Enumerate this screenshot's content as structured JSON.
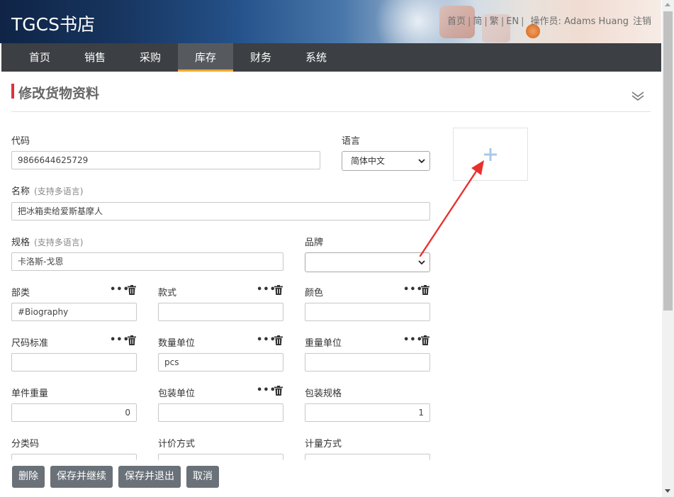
{
  "header": {
    "brand": "TGCS书店",
    "links": {
      "home": "首页",
      "simplified": "简",
      "traditional": "繁",
      "english": "EN"
    },
    "operator_label": "操作员: Adams Huang",
    "logout": "注销"
  },
  "nav": {
    "items": [
      {
        "label": "首页",
        "active": false
      },
      {
        "label": "销售",
        "active": false
      },
      {
        "label": "采购",
        "active": false
      },
      {
        "label": "库存",
        "active": true
      },
      {
        "label": "财务",
        "active": false
      },
      {
        "label": "系统",
        "active": false
      }
    ]
  },
  "page": {
    "title": "修改货物资料"
  },
  "form": {
    "code": {
      "label": "代码",
      "value": "9866644625729"
    },
    "language": {
      "label": "语言",
      "value": "简体中文"
    },
    "name": {
      "label": "名称",
      "hint": "(支持多语言)",
      "value": "把冰箱卖给爱斯基摩人"
    },
    "spec": {
      "label": "规格",
      "hint": "(支持多语言)",
      "value": "卡洛斯-戈恩"
    },
    "brand": {
      "label": "品牌",
      "value": ""
    },
    "category": {
      "label": "部类",
      "value": "#Biography"
    },
    "style": {
      "label": "款式",
      "value": ""
    },
    "color": {
      "label": "颜色",
      "value": ""
    },
    "size_standard": {
      "label": "尺码标准",
      "value": ""
    },
    "quantity_unit": {
      "label": "数量单位",
      "value": "pcs"
    },
    "weight_unit": {
      "label": "重量单位",
      "value": ""
    },
    "unit_weight": {
      "label": "单件重量",
      "value": "0"
    },
    "package_unit": {
      "label": "包装单位",
      "value": ""
    },
    "package_spec": {
      "label": "包装规格",
      "value": "1"
    },
    "classification_code": {
      "label": "分类码",
      "value": ""
    },
    "pricing_method": {
      "label": "计价方式",
      "value": ""
    },
    "measure_method": {
      "label": "计量方式",
      "value": ""
    },
    "more_icon": "ellipsis-icon",
    "delete_icon": "trash-icon"
  },
  "uploader": {
    "icon": "plus-icon"
  },
  "buttons": {
    "delete": "删除",
    "save_continue": "保存并继续",
    "save_exit": "保存并退出",
    "cancel": "取消"
  },
  "colors": {
    "nav_bg": "#3c3f43",
    "nav_active_bg": "#565a5f",
    "nav_active_underline": "#f0a830",
    "title_accent": "#d9363e",
    "button_bg": "#6a7178",
    "annotation_arrow": "#e8312f",
    "upload_plus": "#a8c8ea"
  }
}
